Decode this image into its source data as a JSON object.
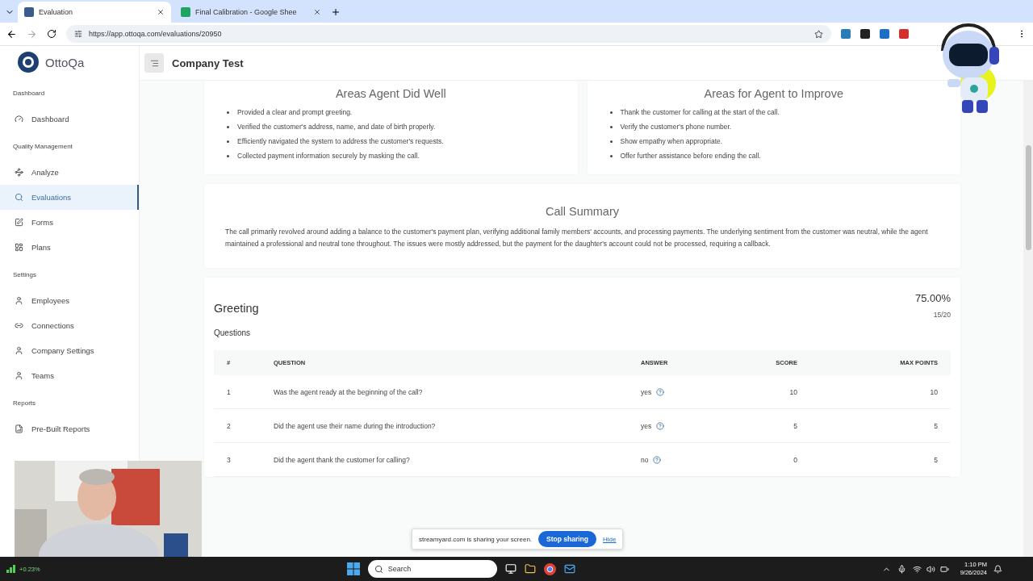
{
  "browser": {
    "tabs": [
      {
        "title": "Evaluation",
        "selected": true
      },
      {
        "title": "Final Calibration - Google Shee",
        "selected": false
      }
    ],
    "url": "https://app.ottoqa.com/evaluations/20950"
  },
  "app": {
    "logo": "OttoQa",
    "header_title": "Company Test",
    "sidebar": [
      {
        "heading": "Dashboard",
        "items": [
          {
            "label": "Dashboard",
            "selected": false
          }
        ]
      },
      {
        "heading": "Quality Management",
        "items": [
          {
            "label": "Analyze",
            "selected": false
          },
          {
            "label": "Evaluations",
            "selected": true
          },
          {
            "label": "Forms",
            "selected": false
          },
          {
            "label": "Plans",
            "selected": false
          }
        ]
      },
      {
        "heading": "Settings",
        "items": [
          {
            "label": "Employees",
            "selected": false
          },
          {
            "label": "Connections",
            "selected": false
          },
          {
            "label": "Company Settings",
            "selected": false
          },
          {
            "label": "Teams",
            "selected": false
          }
        ]
      },
      {
        "heading": "Reports",
        "items": [
          {
            "label": "Pre-Built Reports",
            "selected": false
          }
        ]
      }
    ],
    "areas": [
      {
        "title": "Areas Agent Did Well",
        "items": [
          "Provided a clear and prompt greeting.",
          "Verified the customer's address, name, and date of birth properly.",
          "Efficiently navigated the system to address the customer's requests.",
          "Collected payment information securely by masking the call."
        ]
      },
      {
        "title": "Areas for Agent to Improve",
        "items": [
          "Thank the customer for calling at the start of the call.",
          "Verify the customer's phone number.",
          "Show empathy when appropriate.",
          "Offer further assistance before ending the call."
        ]
      }
    ],
    "summary": {
      "title": "Call Summary",
      "text": "The call primarily revolved around adding a balance to the customer's payment plan, verifying additional family members' accounts, and processing payments. The underlying sentiment from the customer was neutral, while the agent maintained a professional and neutral tone throughout. The issues were mostly addressed, but the payment for the daughter's account could not be processed, requiring a callback."
    },
    "section": {
      "title": "Greeting",
      "percent": "75.00%",
      "points": "15/20",
      "subheading": "Questions",
      "columns": [
        "#",
        "QUESTION",
        "ANSWER",
        "SCORE",
        "MAX POINTS"
      ],
      "rows": [
        {
          "num": "1",
          "question": "Was the agent ready at the beginning of the call?",
          "answer": "yes",
          "score": "10",
          "max": "10"
        },
        {
          "num": "2",
          "question": "Did the agent use their name during the introduction?",
          "answer": "yes",
          "score": "5",
          "max": "5"
        },
        {
          "num": "3",
          "question": "Did the agent thank the customer for calling?",
          "answer": "no",
          "score": "0",
          "max": "5"
        }
      ]
    }
  },
  "sharing": {
    "message": "streamyard.com is sharing your screen.",
    "button": "Stop sharing",
    "link": "Hide"
  },
  "taskbar": {
    "ticker": "+0.23%",
    "search_placeholder": "Search",
    "time": "1:10 PM",
    "date": "9/26/2024"
  }
}
